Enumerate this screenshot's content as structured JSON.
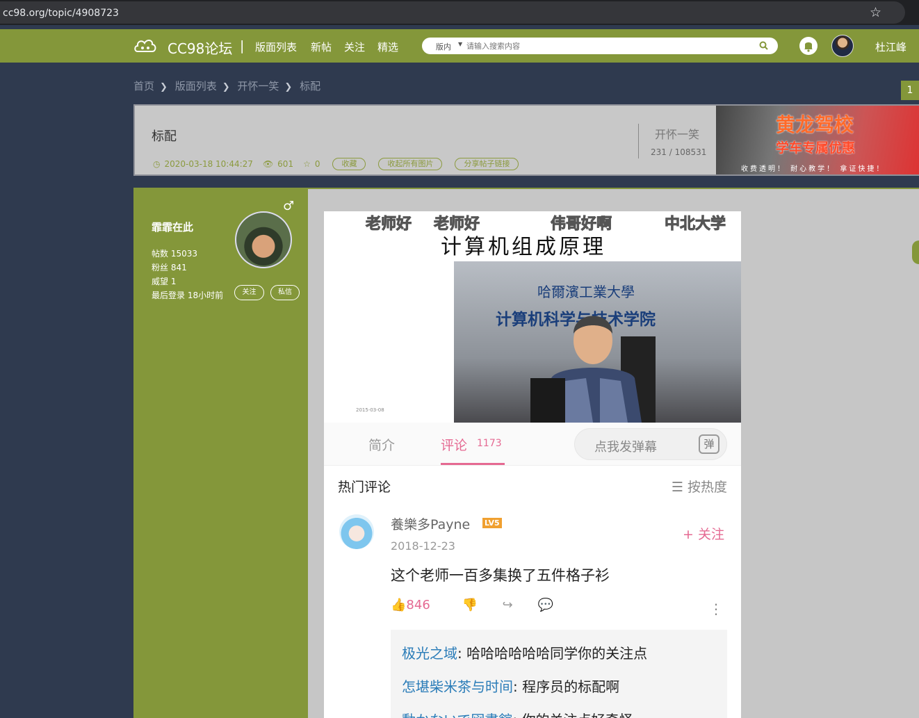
{
  "browser": {
    "url": "cc98.org/topic/4908723"
  },
  "header": {
    "site_title": "CC98论坛",
    "separator": "|",
    "nav": [
      "版面列表",
      "新帖",
      "关注",
      "精选"
    ],
    "search_scope": "版内",
    "search_placeholder": "请输入搜索内容",
    "username": "杜江峰",
    "accent": "#84973a"
  },
  "breadcrumb": [
    "首页",
    "版面列表",
    "开怀一笑",
    "标配"
  ],
  "page_number": "1",
  "topic": {
    "title": "标配",
    "datetime": "2020-03-18 10:44:27",
    "views": "601",
    "stars": "0",
    "buttons": [
      "收藏",
      "收起所有图片",
      "分享帖子链接"
    ],
    "board": "开怀一笑",
    "board_stats": "231 / 108531"
  },
  "ad": {
    "line1": "黄龙驾校",
    "line2": "学车专属优惠",
    "line3": "收费透明！ 耐心教学！ 拿证快捷！"
  },
  "author": {
    "name": "霏霏在此",
    "gender_icon": "♂",
    "posts": "帖数 15033",
    "fans": "粉丝 841",
    "prestige": "威望 1",
    "last_login": "最后登录 18小时前",
    "follow_btn": "关注",
    "message_btn": "私信"
  },
  "screenshot": {
    "danmu": [
      "老师好",
      "老师好",
      "伟哥好啊",
      "中北大学"
    ],
    "video_title": "计算机组成原理",
    "uni_text": "哈爾濱工業大學",
    "dept_text": "计算机科学与技术学院",
    "video_date": "2015-03-08",
    "tab_intro": "简介",
    "tab_comments": "评论",
    "comment_count": "1173",
    "danmu_input": "点我发弹幕",
    "danmu_icon": "弹",
    "hot_comments": "热门评论",
    "sort": "按热度",
    "comment": {
      "user": "養樂多Payne",
      "level": "LV5",
      "date": "2018-12-23",
      "follow": "+ 关注",
      "text": "这个老师一百多集换了五件格子衫",
      "likes": "846"
    },
    "replies": [
      {
        "user": "极光之域",
        "text": ": 哈哈哈哈哈哈同学你的关注点"
      },
      {
        "user": "怎堪柴米茶与时间",
        "text": ": 程序员的标配啊"
      },
      {
        "user": "動かないで図書館",
        "text": ": 你的关注点好奇怪"
      }
    ]
  }
}
